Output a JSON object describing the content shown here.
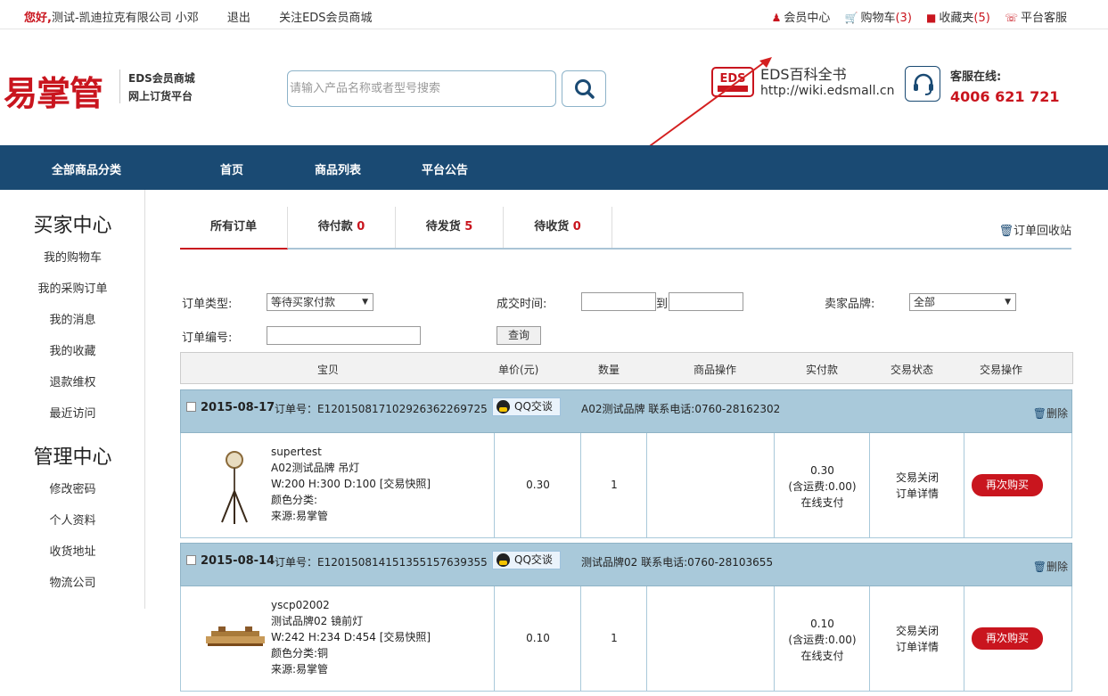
{
  "topbar": {
    "greeting": "您好,",
    "user": "测试-凯迪拉克有限公司 小邓",
    "logout": "退出",
    "follow": "关注EDS会员商城",
    "member_center": "会员中心",
    "cart_label": "购物车",
    "cart_count": "(3)",
    "favorites_label": "收藏夹",
    "favorites_count": "(5)",
    "platform_service": "平台客服"
  },
  "header": {
    "logo_text": "易掌管",
    "logo_sub1": "EDS会员商城",
    "logo_sub2": "网上订货平台",
    "search_placeholder": "请输入产品名称或者型号搜索",
    "eds_badge": "EDS",
    "eds_title": "EDS百科全书",
    "eds_url": "http://wiki.edsmall.cn",
    "service_label": "客服在线:",
    "service_phone": "4006 621 721"
  },
  "nav": {
    "items": [
      "全部商品分类",
      "首页",
      "商品列表",
      "平台公告"
    ]
  },
  "sidebar": {
    "buyer_title": "买家中心",
    "buyer_items": [
      "我的购物车",
      "我的采购订单",
      "我的消息",
      "我的收藏",
      "退款维权",
      "最近访问"
    ],
    "manage_title": "管理中心",
    "manage_items": [
      "修改密码",
      "个人资料",
      "收货地址",
      "物流公司"
    ]
  },
  "tabs": [
    {
      "label": "所有订单",
      "count": ""
    },
    {
      "label": "待付款 ",
      "count": "0"
    },
    {
      "label": "待发货 ",
      "count": "5"
    },
    {
      "label": "待收货 ",
      "count": "0"
    }
  ],
  "recycle": "订单回收站",
  "filter": {
    "type_label": "订单类型:",
    "type_value": "等待买家付款",
    "time_label": "成交时间:",
    "to_label": "到",
    "brand_label": "卖家品牌:",
    "brand_value": "全部",
    "no_label": "订单编号:",
    "query_button": "查询"
  },
  "table_header": [
    "宝贝",
    "单价(元)",
    "数量",
    "商品操作",
    "实付款",
    "交易状态",
    "交易操作"
  ],
  "orders": [
    {
      "date": "2015-08-17",
      "order_no": "订单号：E120150817102926362269725",
      "qq": "QQ交谈",
      "brand": "A02测试品牌  联系电话:0760-28162302",
      "delete": "删除",
      "item": {
        "name": "supertest",
        "line2": "A02测试品牌 吊灯",
        "line3": "W:200 H:300 D:100 [交易快照]",
        "line4": "颜色分类:",
        "line5": "来源:易掌管"
      },
      "unit_price": "0.30",
      "quantity": "1",
      "paid": "0.30",
      "shipping": "(含运费:0.00)",
      "pay_method": "在线支付",
      "status": "交易关闭",
      "detail": "订单详情",
      "rebuy": "再次购买"
    },
    {
      "date": "2015-08-14",
      "order_no": "订单号：E120150814151355157639355",
      "qq": "QQ交谈",
      "brand": "测试品牌02  联系电话:0760-28103655",
      "delete": "删除",
      "item": {
        "name": "yscp02002",
        "line2": "测试品牌02 镜前灯",
        "line3": "W:242 H:234 D:454 [交易快照]",
        "line4": "颜色分类:铜",
        "line5": "来源:易掌管"
      },
      "unit_price": "0.10",
      "quantity": "1",
      "paid": "0.10",
      "shipping": "(含运费:0.00)",
      "pay_method": "在线支付",
      "status": "交易关闭",
      "detail": "订单详情",
      "rebuy": "再次购买"
    }
  ],
  "colors": {
    "accent_red": "#c9151e",
    "nav_blue": "#1a4a73",
    "order_header": "#a9c9da"
  }
}
